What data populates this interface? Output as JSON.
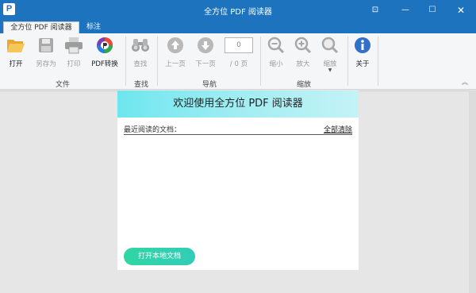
{
  "window": {
    "title": "全方位 PDF 阅读器",
    "logo_letter": "P",
    "controls": {
      "pin": "⊡",
      "minimize": "—",
      "maximize": "☐",
      "close": "✕"
    }
  },
  "tabs": [
    {
      "label": "全方位 PDF 阅读器",
      "active": true
    },
    {
      "label": "标注",
      "active": false
    }
  ],
  "ribbon": {
    "groups": {
      "file": "文件",
      "search": "查找",
      "nav": "导航",
      "zoom": "缩放"
    },
    "buttons": {
      "open": "打开",
      "save_as": "另存为",
      "print": "打印",
      "convert": "PDF转换",
      "find": "查找",
      "prev": "上一页",
      "next": "下一页",
      "zoom_out": "缩小",
      "zoom_in": "放大",
      "zoom": "缩放",
      "about": "关于"
    },
    "page_input": "0",
    "page_total": "/ 0 页"
  },
  "welcome": {
    "title": "欢迎使用全方位 PDF 阅读器",
    "recent_label": "最近阅读的文档：",
    "clear_all": "全部清除",
    "open_local": "打开本地文档"
  },
  "colors": {
    "titlebar": "#1e73be",
    "welcome_gradient_start": "#6ee6ee",
    "open_button": "#2fd6a4"
  }
}
